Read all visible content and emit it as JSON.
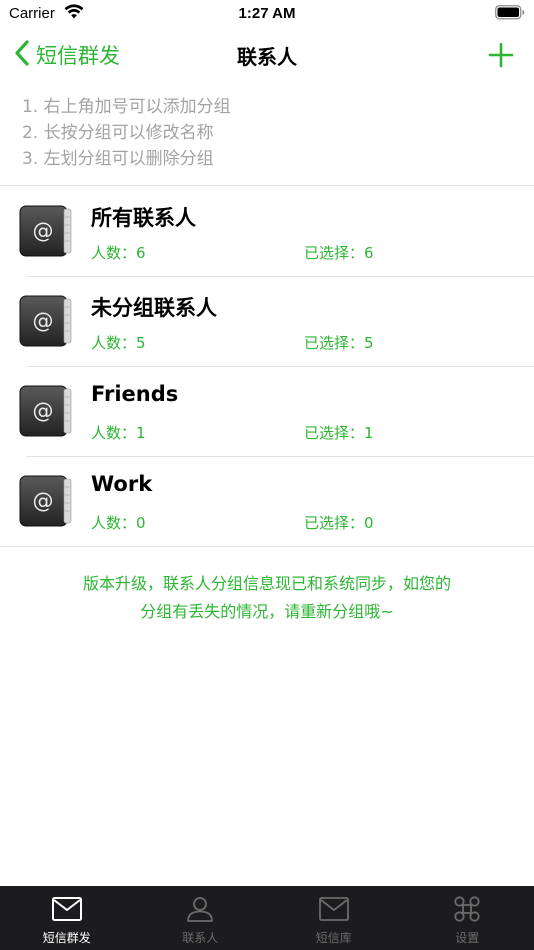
{
  "status_bar": {
    "carrier": "Carrier",
    "time": "1:27 AM"
  },
  "nav": {
    "back_label": "短信群发",
    "title": "联系人",
    "add_icon": "plus-icon"
  },
  "tips": [
    "1. 右上角加号可以添加分组",
    "2. 长按分组可以修改名称",
    "3. 左划分组可以删除分组"
  ],
  "groups": [
    {
      "name": "所有联系人",
      "count_text": "人数：6",
      "selected_text": "已选择：6"
    },
    {
      "name": "未分组联系人",
      "count_text": "人数：5",
      "selected_text": "已选择：5"
    },
    {
      "name": "Friends",
      "count_text": "人数：1",
      "selected_text": "已选择：1"
    },
    {
      "name": "Work",
      "count_text": "人数：0",
      "selected_text": "已选择：0"
    }
  ],
  "notice": {
    "line1": "版本升级，联系人分组信息现已和系统同步，如您的",
    "line2": "分组有丢失的情况，请重新分组哦~"
  },
  "tabs": [
    {
      "label": "短信群发",
      "icon": "envelope-icon",
      "active": true
    },
    {
      "label": "联系人",
      "icon": "person-icon",
      "active": false
    },
    {
      "label": "短信库",
      "icon": "envelope-icon",
      "active": false
    },
    {
      "label": "设置",
      "icon": "command-icon",
      "active": false
    }
  ],
  "colors": {
    "accent": "#2db633",
    "tip_text": "#a3a3a3",
    "tab_bar": "#1c1c1e",
    "tab_inactive": "#6b6b6b",
    "tab_active": "#ffffff"
  }
}
